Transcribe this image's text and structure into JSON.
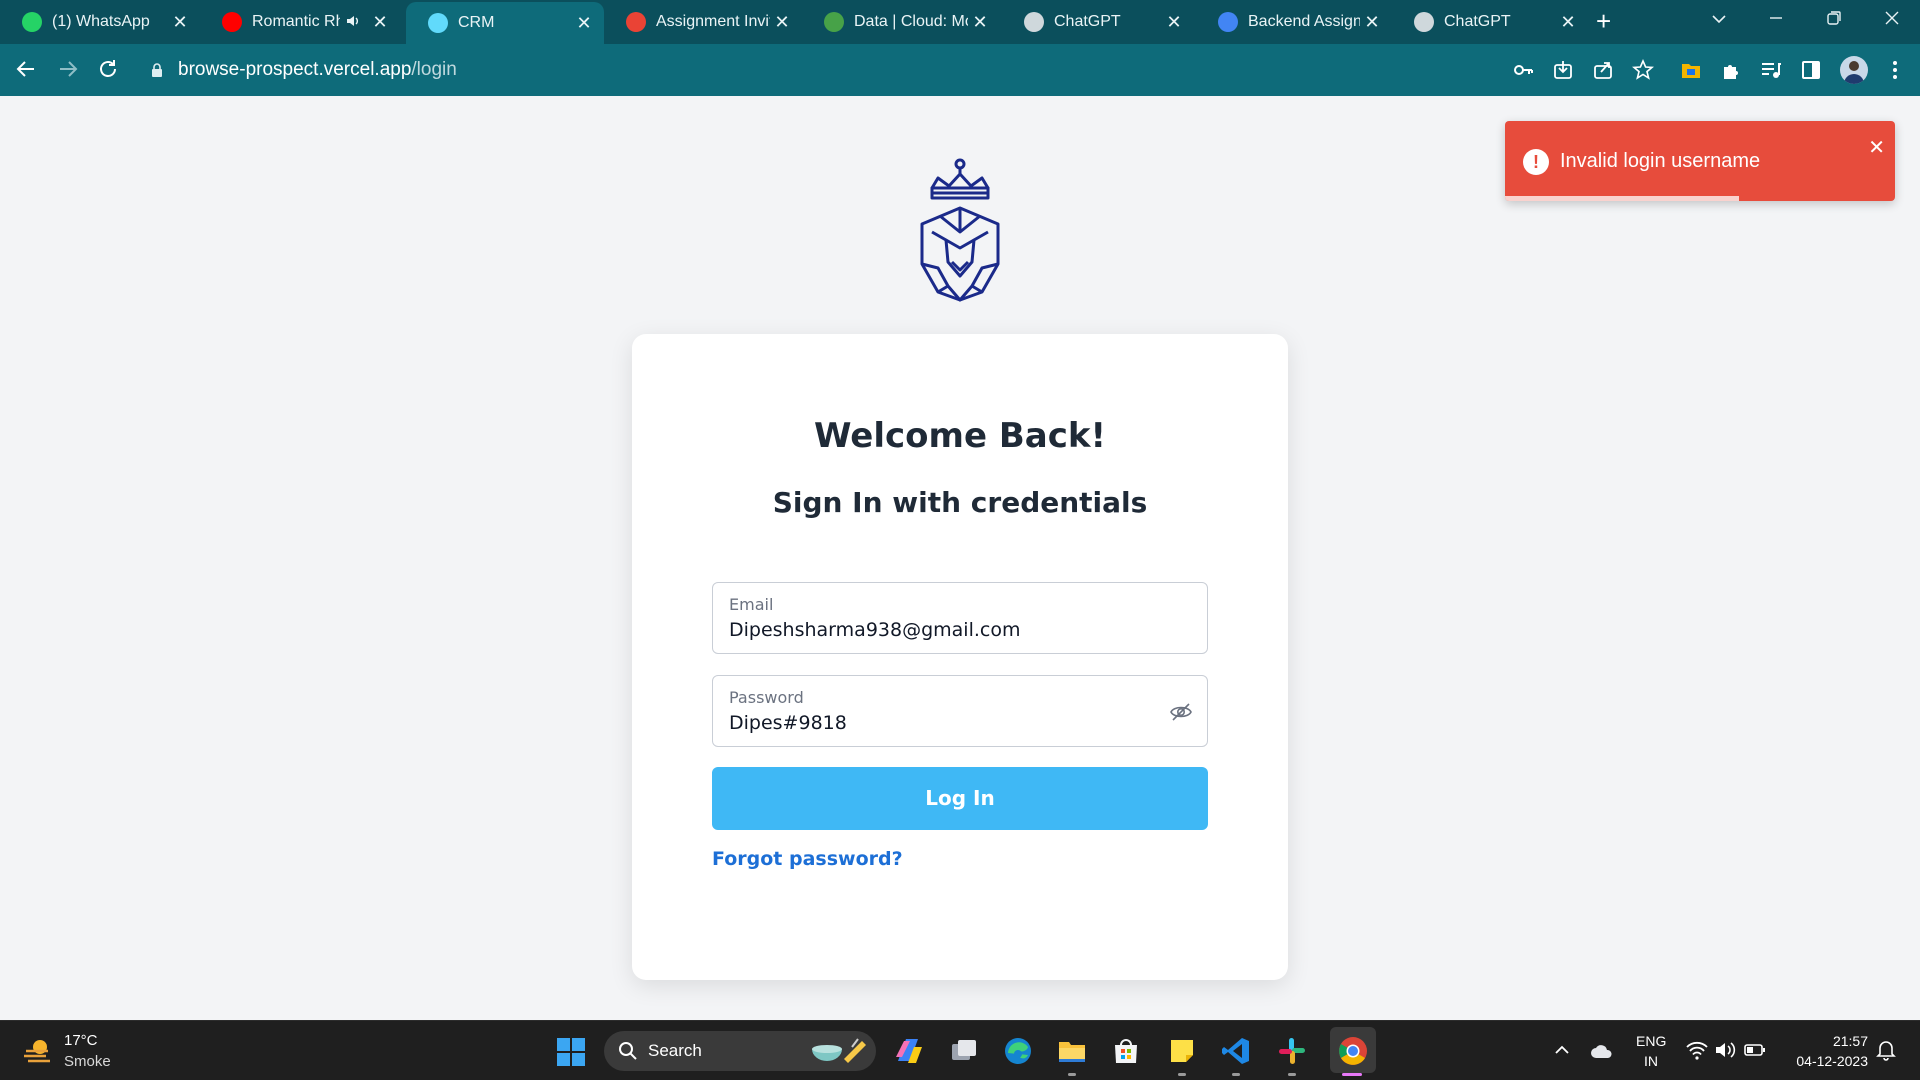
{
  "browser": {
    "tabs": [
      {
        "title": "(1) WhatsApp",
        "icon": "whatsapp-icon",
        "color": "#25d366"
      },
      {
        "title": "Romantic Rh",
        "icon": "youtube-icon",
        "color": "#ff0000",
        "audio": "speaker-icon"
      },
      {
        "title": "CRM",
        "icon": "react-icon",
        "color": "#61dafb",
        "active": true
      },
      {
        "title": "Assignment Invit",
        "icon": "gmail-icon",
        "color": "#ea4335"
      },
      {
        "title": "Data | Cloud: Mo",
        "icon": "mongodb-icon",
        "color": "#47a248"
      },
      {
        "title": "ChatGPT",
        "icon": "chatgpt-icon",
        "color": "#cfd8dc"
      },
      {
        "title": "Backend Assignm",
        "icon": "google-docs-icon",
        "color": "#4285f4"
      },
      {
        "title": "ChatGPT",
        "icon": "chatgpt-icon",
        "color": "#cfd8dc"
      }
    ],
    "close_glyph": "✕",
    "new_tab_glyph": "+",
    "url_host": "browse-prospect.vercel.app",
    "url_path": "/login"
  },
  "page": {
    "heading": "Welcome Back!",
    "subheading": "Sign In with credentials",
    "email": {
      "label": "Email",
      "value": "Dipeshsharma938@gmail.com"
    },
    "password": {
      "label": "Password",
      "value": "Dipes#9818"
    },
    "login_label": "Log In",
    "forgot_label": "Forgot password?",
    "brand_color": "#1b2a8a",
    "button_color": "#3fb8f5"
  },
  "toast": {
    "message": "Invalid login username",
    "icon": "!",
    "close_glyph": "✕",
    "color": "#e74c3c",
    "progress": 0.6
  },
  "taskbar": {
    "weather_temp": "17°C",
    "weather_desc": "Smoke",
    "search_label": "Search",
    "lang_top": "ENG",
    "lang_bottom": "IN",
    "time": "21:57",
    "date": "04-12-2023"
  }
}
